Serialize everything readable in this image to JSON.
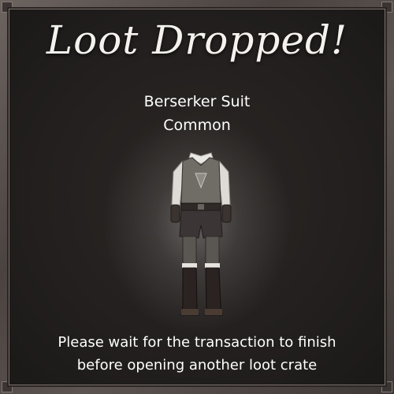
{
  "dialog": {
    "title": "Loot Dropped!",
    "item_name": "Berserker Suit",
    "item_rarity": "Common",
    "item_icon": "berserker-suit-icon",
    "message_line1": "Please wait for the transaction to finish",
    "message_line2": "before opening another loot crate"
  },
  "colors": {
    "text": "#ffffff",
    "panel_background": "#221f1e",
    "frame": "#5c5450"
  }
}
